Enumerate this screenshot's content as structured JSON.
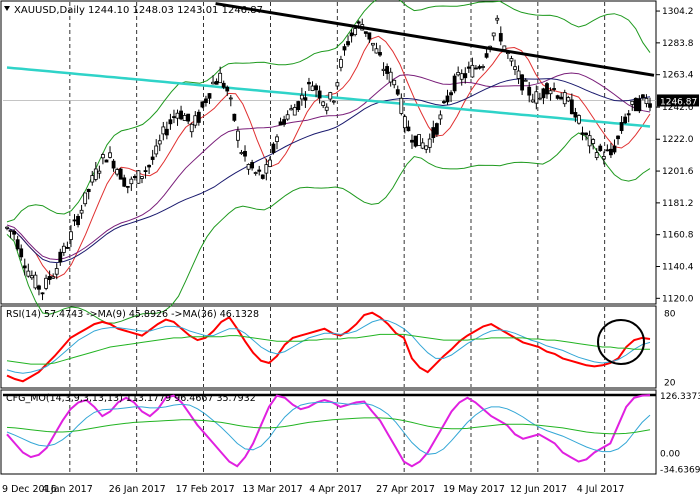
{
  "chart_data": [
    {
      "type": "candlestick",
      "symbol_label": "XAUUSD,Daily",
      "ohlc_label": "1244.10 1248.03 1243.01 1246.87",
      "last_price": 1246.87,
      "ylim": [
        1117,
        1310
      ],
      "y_ticks": [
        1304.2,
        1283.8,
        1263.4,
        1242.6,
        1222.0,
        1201.6,
        1181.2,
        1160.8,
        1140.4,
        1120.0
      ],
      "price_path": [
        1165,
        1162,
        1150,
        1138,
        1130,
        1125,
        1133,
        1140,
        1150,
        1160,
        1172,
        1183,
        1195,
        1205,
        1212,
        1208,
        1200,
        1192,
        1196,
        1200,
        1205,
        1213,
        1225,
        1233,
        1240,
        1237,
        1230,
        1236,
        1248,
        1258,
        1262,
        1253,
        1235,
        1215,
        1205,
        1200,
        1198,
        1205,
        1225,
        1235,
        1240,
        1245,
        1252,
        1258,
        1252,
        1245,
        1250,
        1270,
        1285,
        1293,
        1296,
        1288,
        1278,
        1268,
        1262,
        1255,
        1232,
        1225,
        1220,
        1218,
        1225,
        1235,
        1248,
        1258,
        1262,
        1265,
        1268,
        1272,
        1285,
        1295,
        1282,
        1270,
        1262,
        1255,
        1250,
        1248,
        1256,
        1254,
        1250,
        1245,
        1240,
        1226,
        1220,
        1215,
        1213,
        1212,
        1222,
        1235,
        1242,
        1245,
        1247
      ],
      "resistance_line": [
        [
          0.05,
          1309
        ],
        [
          1.0,
          1263
        ]
      ],
      "indicator_colors": {
        "candles": "#000000",
        "bollinger": "#1f9a1f",
        "ma_red": "#e03030",
        "ma_purple": "#7a1f7a",
        "ma_navy": "#1a1a6e",
        "ma_cyan": "#2fd3c8",
        "trendline": "#000000"
      }
    },
    {
      "type": "line",
      "indicator_label": "RSI(14) 57.4743 ->MA(9) 45.8926 ->MA(36) 46.1328",
      "ylim": [
        15,
        85
      ],
      "y_ticks": [
        80,
        20
      ],
      "series": [
        {
          "name": "RSI(14)",
          "color": "#ff0000",
          "values": [
            25,
            22,
            20,
            24,
            28,
            35,
            42,
            50,
            58,
            62,
            66,
            70,
            72,
            70,
            66,
            64,
            62,
            60,
            65,
            70,
            74,
            72,
            66,
            60,
            56,
            58,
            64,
            72,
            76,
            66,
            55,
            45,
            38,
            36,
            42,
            52,
            58,
            60,
            62,
            64,
            66,
            62,
            60,
            64,
            70,
            78,
            80,
            76,
            70,
            62,
            58,
            40,
            32,
            28,
            35,
            42,
            48,
            55,
            60,
            64,
            68,
            70,
            66,
            62,
            58,
            54,
            52,
            50,
            46,
            44,
            40,
            38,
            36,
            34,
            33,
            34,
            36,
            40,
            50,
            56,
            58,
            57
          ]
        },
        {
          "name": "MA(9)",
          "color": "#34a7d6",
          "values": [
            30,
            28,
            27,
            28,
            30,
            33,
            38,
            44,
            50,
            56,
            60,
            64,
            66,
            67,
            67,
            66,
            65,
            64,
            64,
            66,
            68,
            68,
            67,
            64,
            62,
            60,
            60,
            63,
            66,
            66,
            62,
            56,
            50,
            46,
            44,
            46,
            50,
            54,
            58,
            60,
            62,
            62,
            61,
            62,
            64,
            68,
            72,
            74,
            73,
            70,
            66,
            60,
            52,
            45,
            40,
            40,
            43,
            48,
            53,
            57,
            61,
            64,
            65,
            64,
            62,
            59,
            56,
            54,
            51,
            49,
            47,
            44,
            41,
            39,
            37,
            36,
            37,
            39,
            43,
            48,
            52,
            54
          ]
        },
        {
          "name": "MA(36)",
          "color": "#22b422",
          "values": [
            38,
            37,
            36,
            35,
            35,
            35,
            36,
            38,
            40,
            42,
            44,
            46,
            48,
            50,
            51,
            52,
            53,
            54,
            55,
            56,
            57,
            58,
            58,
            59,
            59,
            59,
            59,
            59,
            60,
            60,
            59,
            58,
            57,
            56,
            55,
            55,
            55,
            55,
            56,
            56,
            57,
            57,
            57,
            58,
            58,
            59,
            60,
            61,
            61,
            61,
            61,
            60,
            59,
            58,
            57,
            56,
            56,
            56,
            56,
            57,
            57,
            58,
            58,
            58,
            58,
            58,
            57,
            57,
            56,
            56,
            55,
            54,
            53,
            52,
            51,
            50,
            50,
            49,
            49,
            48,
            48,
            48
          ]
        }
      ]
    },
    {
      "type": "line",
      "indicator_label": "CFG_MO(14,3,9,3,13,13) 113.1779 96.4667 35.7932",
      "ylim": [
        -45,
        135
      ],
      "y_ticks": [
        126.3373,
        0.0,
        -34.6369
      ],
      "level_line": 126.3373,
      "series": [
        {
          "name": "CFG_MO",
          "color": "#e020e0",
          "values": [
            40,
            20,
            0,
            -10,
            -5,
            10,
            40,
            70,
            95,
            110,
            115,
            100,
            80,
            90,
            110,
            120,
            110,
            90,
            80,
            95,
            120,
            125,
            110,
            85,
            60,
            40,
            20,
            0,
            -20,
            -30,
            -10,
            20,
            60,
            100,
            125,
            120,
            105,
            95,
            100,
            110,
            115,
            110,
            100,
            105,
            110,
            112,
            90,
            70,
            40,
            10,
            -20,
            -30,
            -20,
            0,
            30,
            60,
            90,
            110,
            120,
            110,
            95,
            80,
            70,
            60,
            40,
            30,
            35,
            40,
            30,
            20,
            0,
            -10,
            -20,
            -15,
            0,
            10,
            20,
            60,
            100,
            120,
            125,
            126
          ]
        },
        {
          "name": "CFG_MO signal",
          "color": "#34a7d6",
          "values": [
            45,
            38,
            30,
            22,
            16,
            14,
            18,
            28,
            42,
            60,
            76,
            88,
            94,
            95,
            96,
            98,
            100,
            100,
            98,
            98,
            100,
            104,
            106,
            104,
            96,
            84,
            70,
            55,
            38,
            20,
            8,
            6,
            14,
            32,
            56,
            78,
            94,
            104,
            108,
            110,
            110,
            110,
            108,
            106,
            106,
            108,
            104,
            96,
            84,
            66,
            44,
            22,
            6,
            -4,
            -2,
            8,
            26,
            46,
            66,
            82,
            94,
            100,
            100,
            96,
            88,
            78,
            66,
            56,
            48,
            42,
            36,
            28,
            20,
            12,
            6,
            2,
            2,
            8,
            22,
            44,
            66,
            82
          ]
        },
        {
          "name": "CFG_MO slow",
          "color": "#22b422",
          "values": [
            55,
            54,
            52,
            50,
            48,
            46,
            45,
            45,
            46,
            48,
            51,
            54,
            57,
            60,
            62,
            64,
            66,
            67,
            68,
            69,
            70,
            71,
            72,
            72,
            71,
            70,
            68,
            66,
            63,
            60,
            57,
            55,
            54,
            54,
            55,
            57,
            60,
            63,
            66,
            68,
            70,
            72,
            73,
            74,
            75,
            76,
            76,
            76,
            75,
            73,
            70,
            66,
            62,
            58,
            55,
            53,
            52,
            52,
            53,
            55,
            57,
            59,
            61,
            62,
            62,
            62,
            61,
            60,
            58,
            56,
            54,
            51,
            48,
            45,
            43,
            42,
            41,
            41,
            42,
            44,
            47,
            50
          ]
        }
      ]
    }
  ],
  "x_axis": {
    "labels": [
      "9 Dec 2016",
      "4 Jan 2017",
      "26 Jan 2017",
      "17 Feb 2017",
      "13 Mar 2017",
      "4 Apr 2017",
      "27 Apr 2017",
      "19 May 2017",
      "12 Jun 2017",
      "4 Jul 2017"
    ]
  }
}
